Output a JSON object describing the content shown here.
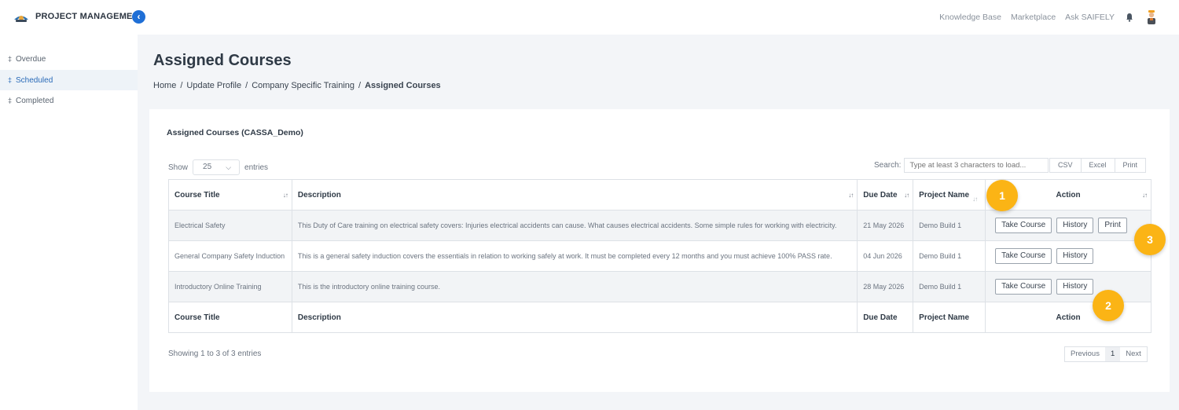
{
  "header": {
    "brand": "PROJECT MANAGEMENT",
    "nav": [
      "Knowledge Base",
      "Marketplace",
      "Ask SAIFELY"
    ]
  },
  "sidebar": {
    "items": [
      {
        "label": "Overdue"
      },
      {
        "label": "Scheduled",
        "active": true
      },
      {
        "label": "Completed"
      }
    ]
  },
  "page": {
    "title": "Assigned Courses",
    "breadcrumb": [
      "Home",
      "Update Profile",
      "Company Specific Training",
      "Assigned Courses"
    ]
  },
  "card": {
    "title": "Assigned Courses (CASSA_Demo)",
    "show_label": "Show",
    "entries_value": "25",
    "entries_label": "entries",
    "search_label": "Search:",
    "search_placeholder": "Type at least 3 characters to load...",
    "export": [
      "CSV",
      "Excel",
      "Print"
    ]
  },
  "table": {
    "headers": [
      "Course Title",
      "Description",
      "Due Date",
      "Project Name",
      "Action"
    ],
    "rows": [
      {
        "title": "Electrical Safety",
        "description": "This Duty of Care training on electrical safety covers: Injuries electrical accidents can cause. What causes electrical accidents. Some simple rules for working with electricity.",
        "due": "21 May 2026",
        "project": "Demo Build 1",
        "actions": [
          "Take Course",
          "History",
          "Print"
        ]
      },
      {
        "title": "General Company Safety Induction",
        "description": "This is a general safety induction covers the essentials in relation to working safely at work. It must be completed every 12 months and you must achieve 100% PASS rate.",
        "due": "04 Jun 2026",
        "project": "Demo Build 1",
        "actions": [
          "Take Course",
          "History"
        ]
      },
      {
        "title": "Introductory Online Training",
        "description": "This is the introductory online training course.",
        "due": "28 May 2026",
        "project": "Demo Build 1",
        "actions": [
          "Take Course",
          "History"
        ]
      }
    ],
    "footer": [
      "Course Title",
      "Description",
      "Due Date",
      "Project Name",
      "Action"
    ]
  },
  "info": "Showing 1 to 3 of 3 entries",
  "pager": {
    "prev": "Previous",
    "page": "1",
    "next": "Next"
  },
  "markers": [
    "1",
    "2",
    "3"
  ],
  "colors": {
    "accent": "#1f6fd6",
    "marker": "#fbb415",
    "active_bg": "#eef3f8"
  }
}
